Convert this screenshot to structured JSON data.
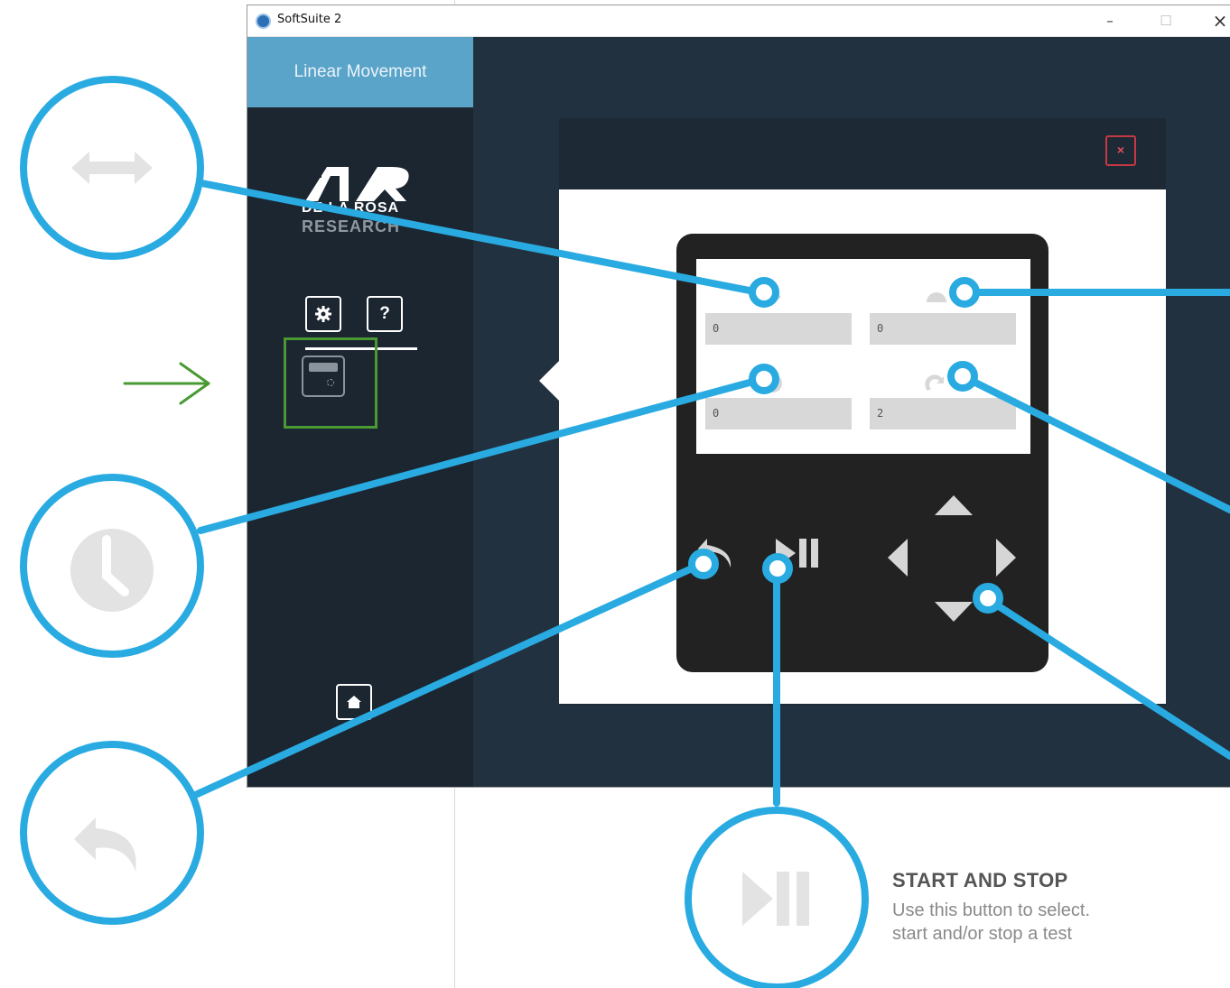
{
  "window": {
    "title": "SoftSuite 2",
    "controls": {
      "minimize": "–",
      "maximize": "☐",
      "close": "×"
    }
  },
  "sidebar": {
    "active_tab": "Linear Movement",
    "logo": {
      "line1": "DE LA ROSA",
      "line2": "RESEARCH"
    },
    "buttons": {
      "settings_icon": "gear-icon",
      "help_label": "?",
      "home_icon": "home-icon",
      "device_icon": "remote-control-icon"
    }
  },
  "modal": {
    "close_label": "×",
    "fields": [
      {
        "name": "distance",
        "icon": "horizontal-arrow-icon",
        "value": "0"
      },
      {
        "name": "speed",
        "icon": "speedometer-icon",
        "value": "0"
      },
      {
        "name": "time",
        "icon": "clock-icon",
        "value": "0"
      },
      {
        "name": "repetitions",
        "icon": "repeat-icon",
        "value": "2"
      }
    ],
    "controls": [
      "back-icon",
      "play-pause-icon",
      "arrow-up-icon",
      "arrow-left-icon",
      "arrow-right-icon",
      "arrow-down-icon"
    ]
  },
  "callouts": [
    "horizontal-arrow-icon",
    "clock-icon",
    "back-icon",
    "play-pause-icon"
  ],
  "note": {
    "title": "START AND STOP",
    "line1": "Use this button to select.",
    "line2": "start and/or stop a test"
  },
  "colors": {
    "callout_blue": "#29abe2",
    "highlight_green": "#4a9a33",
    "window_bg": "#22313f",
    "sidebar_bg": "#1b2631",
    "tab_active": "#5aa3c9",
    "close_red": "#c63844"
  }
}
